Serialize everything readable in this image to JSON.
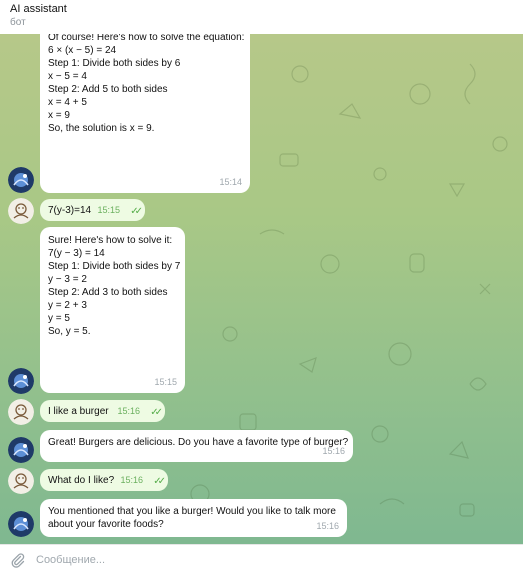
{
  "header": {
    "title": "AI assistant",
    "subtitle": "бот"
  },
  "messages": [
    {
      "type": "in",
      "lines": [
        "Of course! Here's how to solve the equation:",
        "",
        "6 × (x − 5) = 24",
        "",
        "Step 1: Divide both sides by 6",
        "x − 5 = 4",
        "",
        "Step 2: Add 5 to both sides",
        "x = 4 + 5",
        "x = 9",
        "",
        "So, the solution is x = 9."
      ],
      "time": "15:14"
    },
    {
      "type": "out",
      "text": "7(y-3)=14",
      "time": "15:15"
    },
    {
      "type": "in",
      "lines": [
        "Sure! Here's how to solve it:",
        "",
        "7(y − 3) = 14",
        "",
        "Step 1: Divide both sides by 7",
        "y − 3 = 2",
        "",
        "Step 2: Add 3 to both sides",
        "y = 2 + 3",
        "y = 5",
        "",
        "So, y = 5."
      ],
      "time": "15:15"
    },
    {
      "type": "out",
      "text": "I like a burger",
      "time": "15:16"
    },
    {
      "type": "in",
      "lines": [
        "Great! Burgers are delicious. Do you have a favorite type of burger?"
      ],
      "time": "15:16"
    },
    {
      "type": "out",
      "text": "What do I like?",
      "time": "15:16"
    },
    {
      "type": "in",
      "lines": [
        "You mentioned that you like a burger! Would you like to talk more",
        "about your favorite foods?"
      ],
      "time": "15:16"
    }
  ],
  "compose": {
    "placeholder": "Сообщение..."
  },
  "colors": {
    "outgoing_bubble": "#eefbe3",
    "incoming_bubble": "#ffffff",
    "read_check": "#56ad4a"
  },
  "icons": {
    "attach": "paperclip-icon",
    "read": "double-check-icon"
  }
}
